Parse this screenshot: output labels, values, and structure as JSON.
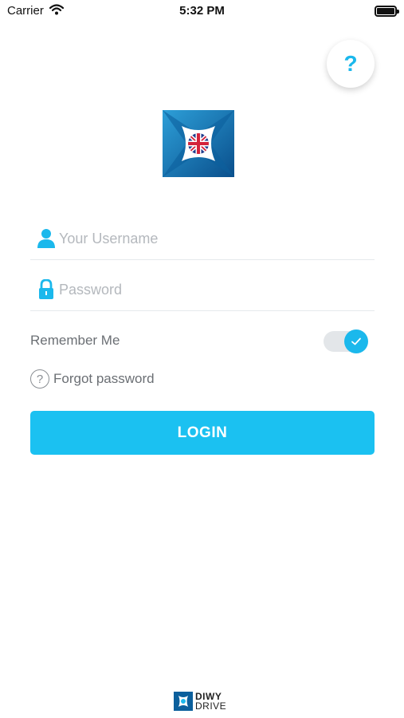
{
  "status_bar": {
    "carrier": "Carrier",
    "time": "5:32 PM"
  },
  "help_button": {
    "label": "?"
  },
  "login_form": {
    "username_placeholder": "Your Username",
    "password_placeholder": "Password",
    "remember_me_label": "Remember Me",
    "remember_me_on": true,
    "forgot_password_label": "Forgot password",
    "login_label": "LOGIN"
  },
  "footer": {
    "brand_line1": "DIWY",
    "brand_line2": "DRIVE"
  },
  "colors": {
    "accent": "#1bc1f1",
    "muted_text": "#6b6f74",
    "placeholder": "#b4b8bd"
  }
}
